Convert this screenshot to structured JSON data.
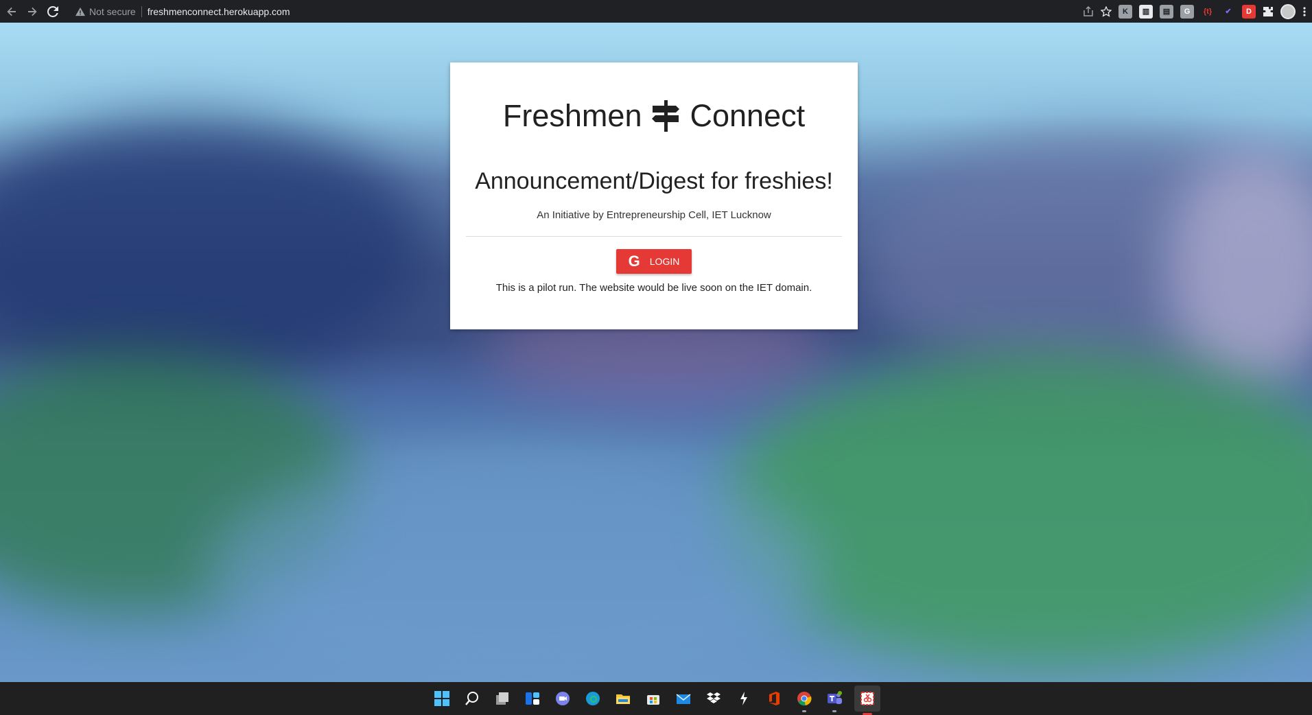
{
  "browser": {
    "security_label": "Not secure",
    "url": "freshmenconnect.herokuapp.com",
    "extensions": [
      "K",
      "chart",
      "box",
      "G",
      "{t}",
      "check",
      "D"
    ]
  },
  "card": {
    "brand_left": "Freshmen",
    "brand_icon": "signpost-icon",
    "brand_right": "Connect",
    "headline": "Announcement/Digest for freshies!",
    "subline": "An Initiative by Entrepreneurship Cell, IET Lucknow",
    "login_label": "LOGIN",
    "login_icon": "google-icon",
    "note": "This is a pilot run. The website would be live soon on the IET domain."
  },
  "colors": {
    "login_button": "#e53935",
    "card_bg": "#ffffff",
    "toolbar_bg": "#202124",
    "taskbar_bg": "#202020"
  },
  "taskbar": {
    "apps": [
      "start-icon",
      "search-icon",
      "task-view-icon",
      "widgets-icon",
      "chat-icon",
      "edge-icon",
      "file-explorer-icon",
      "store-icon",
      "mail-icon",
      "dropbox-icon",
      "app-icon",
      "office-icon",
      "chrome-icon",
      "teams-icon",
      "snipping-tool-icon"
    ]
  }
}
